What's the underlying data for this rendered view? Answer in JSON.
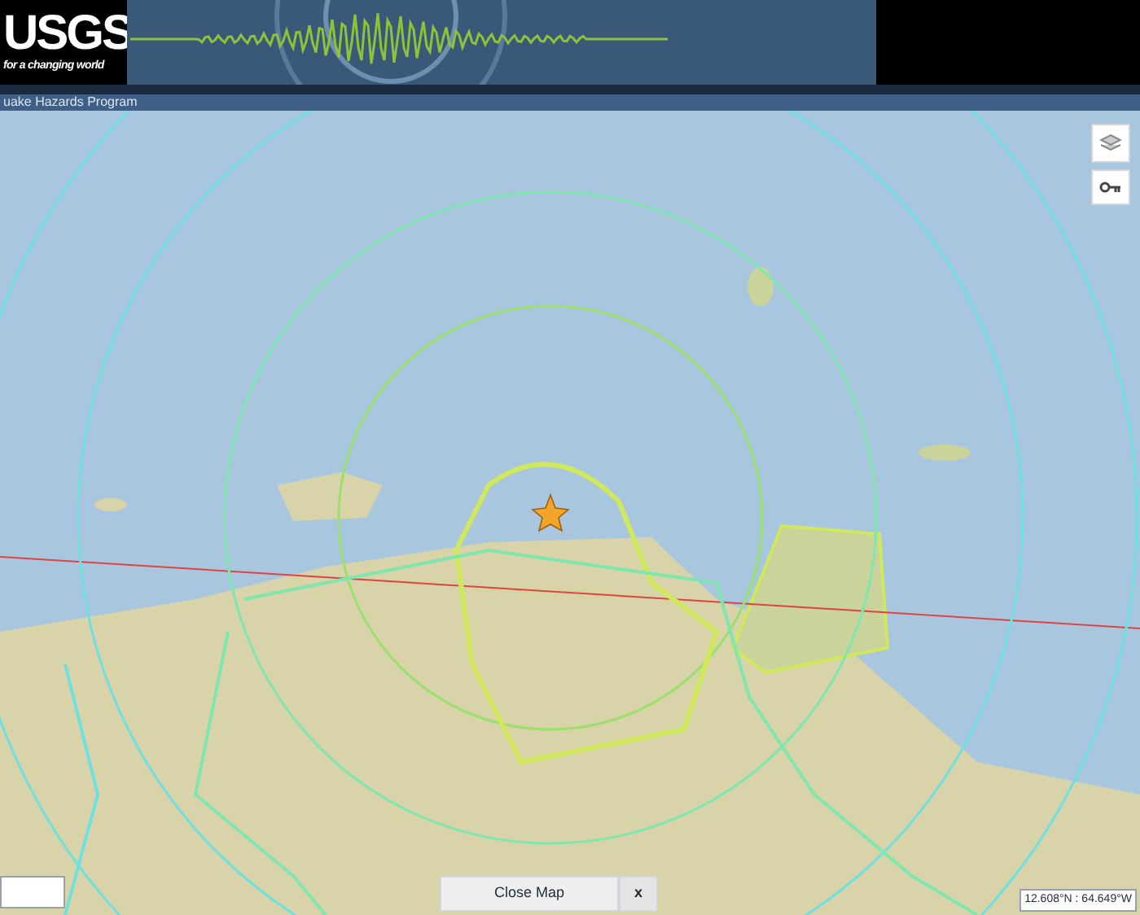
{
  "header": {
    "logo": "USGS",
    "tagline": "for a changing world",
    "program": "uake Hazards Program"
  },
  "map": {
    "close_button": "Close Map",
    "dismiss_button": "x",
    "coordinates": "12.608°N : 64.649°W"
  }
}
